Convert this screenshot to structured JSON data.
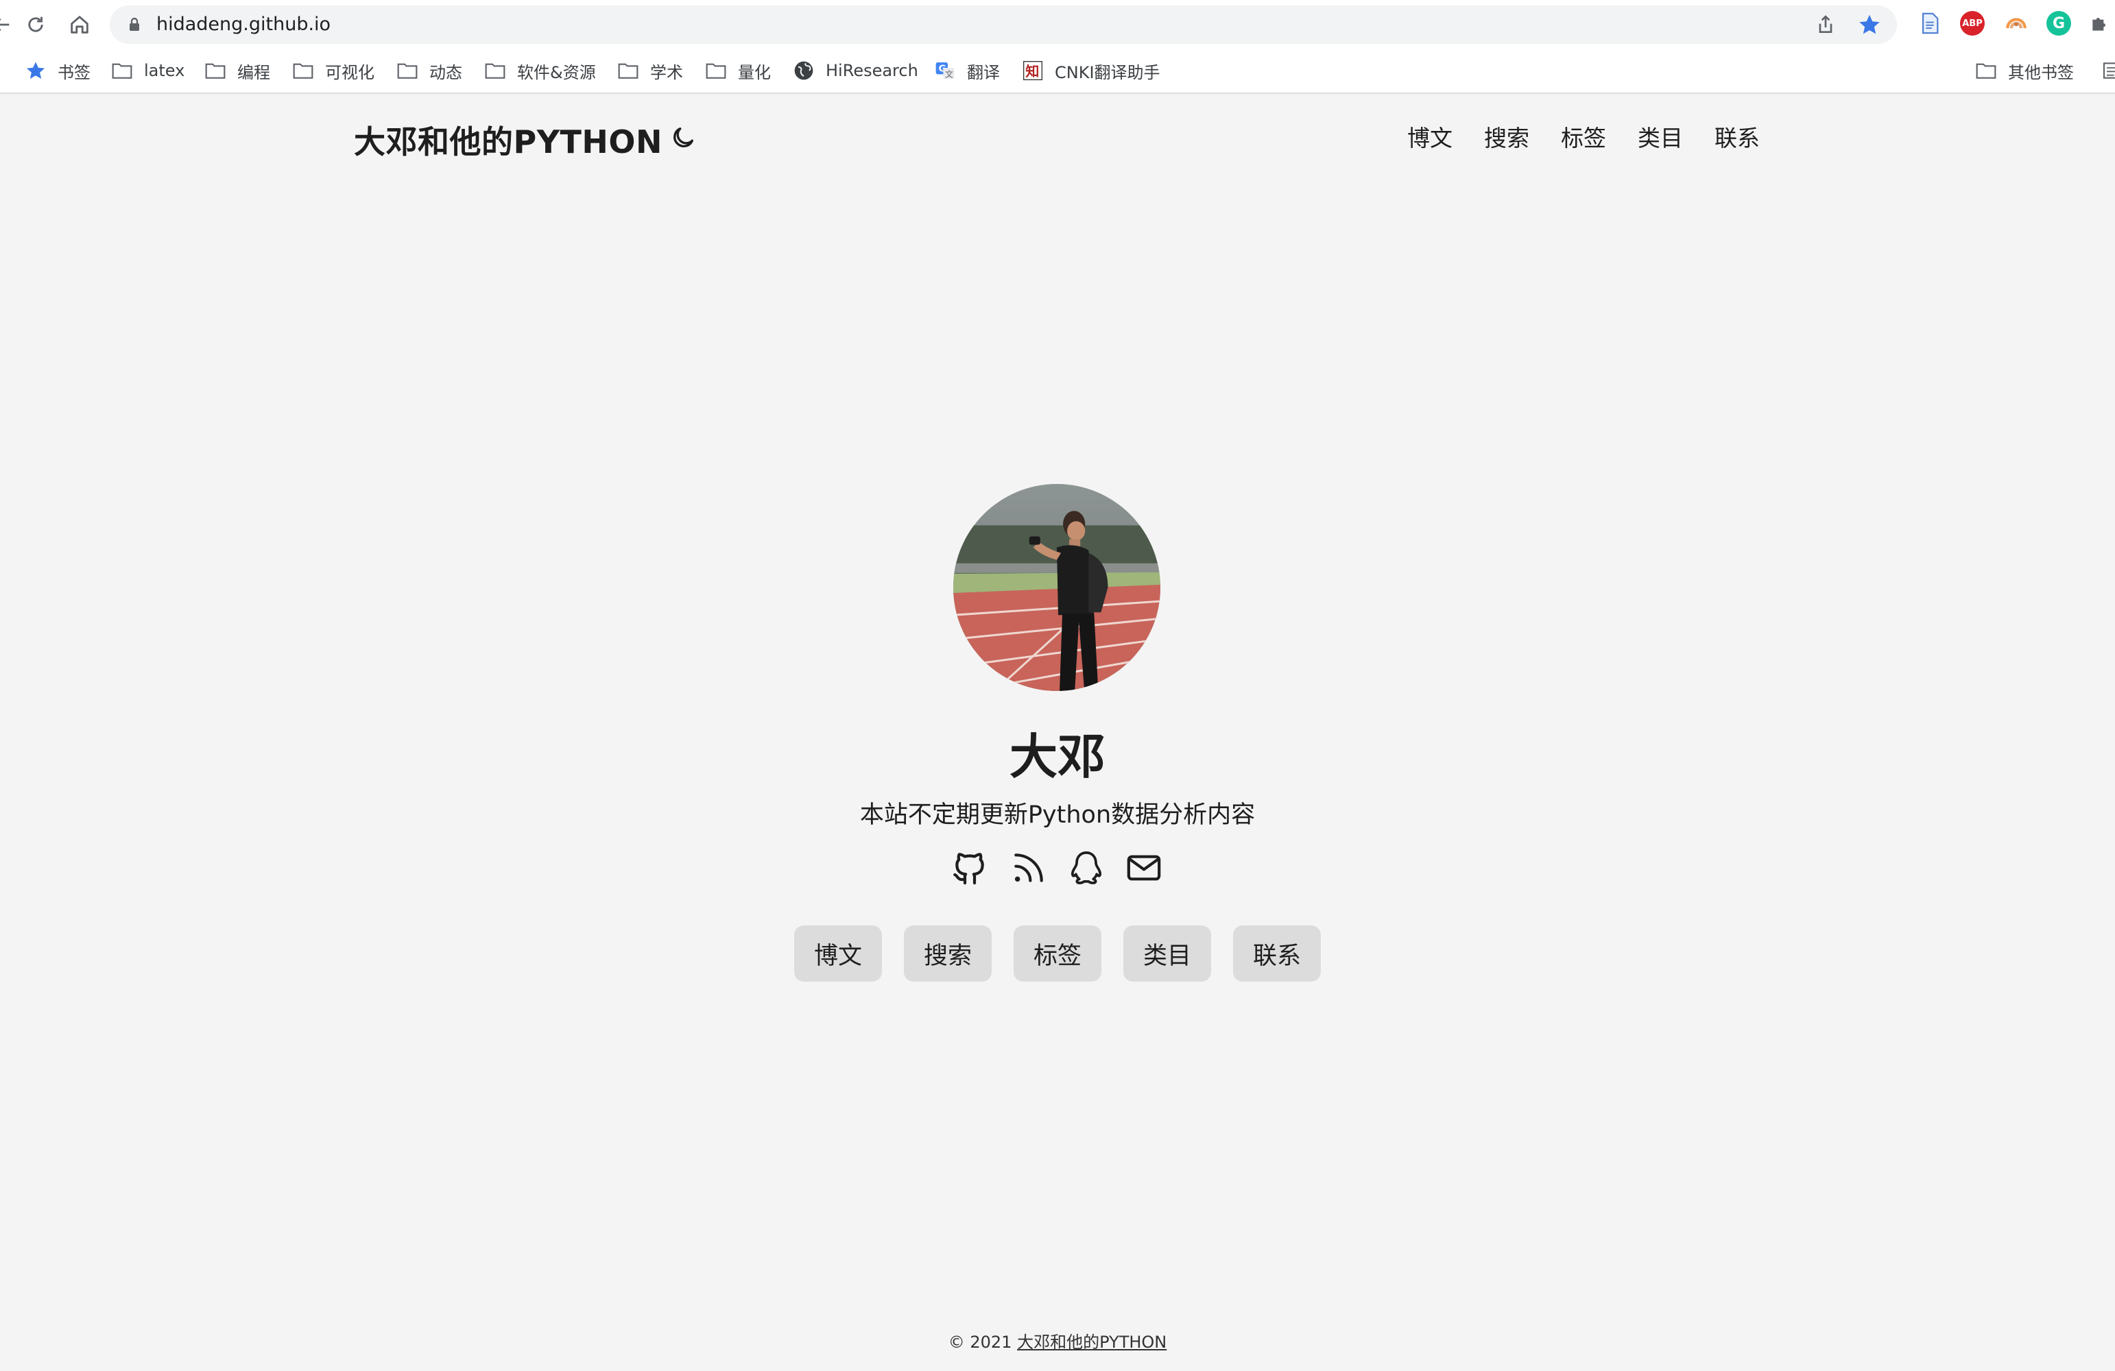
{
  "browser": {
    "url": "hidadeng.github.io",
    "accent": "#3b78e7",
    "extensions": [
      {
        "name": "doc-extension",
        "label": ""
      },
      {
        "name": "adblock-plus",
        "label": "ABP"
      },
      {
        "name": "rainbow-extension",
        "label": ""
      },
      {
        "name": "grammarly",
        "label": "G"
      },
      {
        "name": "extensions-puzzle",
        "label": ""
      }
    ]
  },
  "bookmarks": [
    {
      "label": "书签",
      "icon": "star-icon"
    },
    {
      "label": "latex",
      "icon": "folder-icon"
    },
    {
      "label": "编程",
      "icon": "folder-icon"
    },
    {
      "label": "可视化",
      "icon": "folder-icon"
    },
    {
      "label": "动态",
      "icon": "folder-icon"
    },
    {
      "label": "软件&资源",
      "icon": "folder-icon"
    },
    {
      "label": "学术",
      "icon": "folder-icon"
    },
    {
      "label": "量化",
      "icon": "folder-icon"
    },
    {
      "label": "HiResearch",
      "icon": "globe-icon"
    },
    {
      "label": "翻译",
      "icon": "translate-icon"
    },
    {
      "label": "CNKI翻译助手",
      "icon": "cnki-icon"
    },
    {
      "label": "其他书签",
      "icon": "folder-icon"
    }
  ],
  "site": {
    "title": "大邓和他的PYTHON",
    "nav": [
      "博文",
      "搜索",
      "标签",
      "类目",
      "联系"
    ]
  },
  "profile": {
    "name": "大邓",
    "subtitle": "本站不定期更新Python数据分析内容",
    "social": [
      "github-icon",
      "rss-icon",
      "qq-icon",
      "mail-icon"
    ],
    "buttons": [
      "博文",
      "搜索",
      "标签",
      "类目",
      "联系"
    ]
  },
  "footer": {
    "copyright": "© 2021",
    "link": "大邓和他的PYTHON"
  }
}
